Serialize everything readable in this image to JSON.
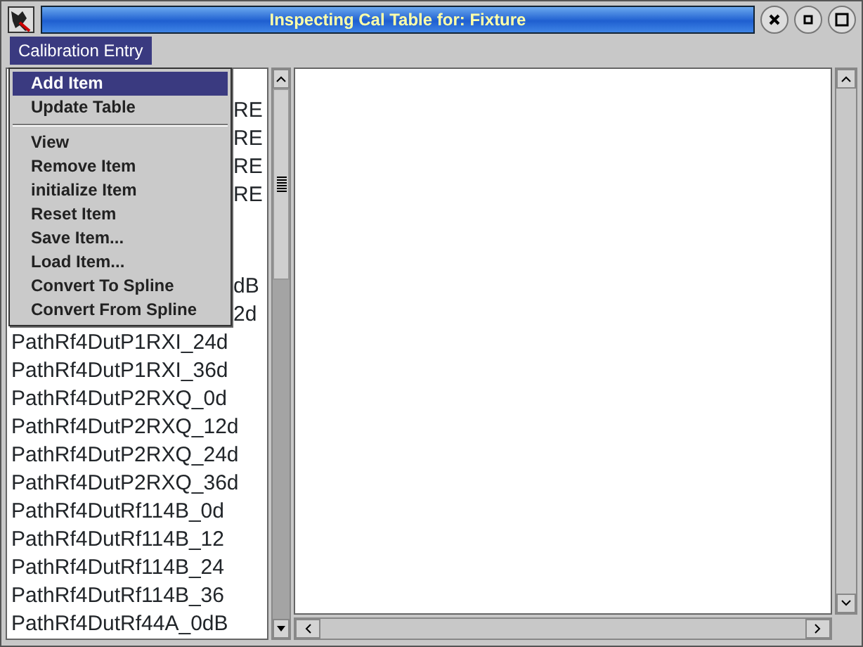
{
  "window": {
    "title": "Inspecting Cal Table for: Fixture"
  },
  "menubar": [
    {
      "label": "Calibration Entry",
      "selected": true
    }
  ],
  "menu": {
    "items": [
      {
        "kind": "item",
        "label": "Add Item",
        "selected": true
      },
      {
        "kind": "item",
        "label": "Update Table",
        "selected": false
      },
      {
        "kind": "separator"
      },
      {
        "kind": "item",
        "label": "View",
        "selected": false
      },
      {
        "kind": "item",
        "label": "Remove Item",
        "selected": false
      },
      {
        "kind": "item",
        "label": "initialize Item",
        "selected": false
      },
      {
        "kind": "item",
        "label": "Reset Item",
        "selected": false
      },
      {
        "kind": "item",
        "label": "Save Item...",
        "selected": false
      },
      {
        "kind": "item",
        "label": "Load Item...",
        "selected": false
      },
      {
        "kind": "item",
        "label": "Convert To Spline",
        "selected": false
      },
      {
        "kind": "item",
        "label": "Convert From Spline",
        "selected": false
      }
    ]
  },
  "list": {
    "rows": [
      {
        "kind": "partial",
        "text": "RE"
      },
      {
        "kind": "partial",
        "text": "RE"
      },
      {
        "kind": "partial",
        "text": "RE"
      },
      {
        "kind": "partial",
        "text": "RE"
      },
      {
        "kind": "partial",
        "text": "dB"
      },
      {
        "kind": "partial",
        "text": "2d"
      },
      {
        "kind": "full",
        "text": "PathRf4DutP1RXI_24d"
      },
      {
        "kind": "full",
        "text": "PathRf4DutP1RXI_36d"
      },
      {
        "kind": "full",
        "text": "PathRf4DutP2RXQ_0d"
      },
      {
        "kind": "full",
        "text": "PathRf4DutP2RXQ_12d"
      },
      {
        "kind": "full",
        "text": "PathRf4DutP2RXQ_24d"
      },
      {
        "kind": "full",
        "text": "PathRf4DutP2RXQ_36d"
      },
      {
        "kind": "full",
        "text": "PathRf4DutRf114B_0d"
      },
      {
        "kind": "full",
        "text": "PathRf4DutRf114B_12"
      },
      {
        "kind": "full",
        "text": "PathRf4DutRf114B_24"
      },
      {
        "kind": "full",
        "text": "PathRf4DutRf114B_36"
      },
      {
        "kind": "full",
        "text": "PathRf4DutRf44A_0dB"
      }
    ]
  }
}
